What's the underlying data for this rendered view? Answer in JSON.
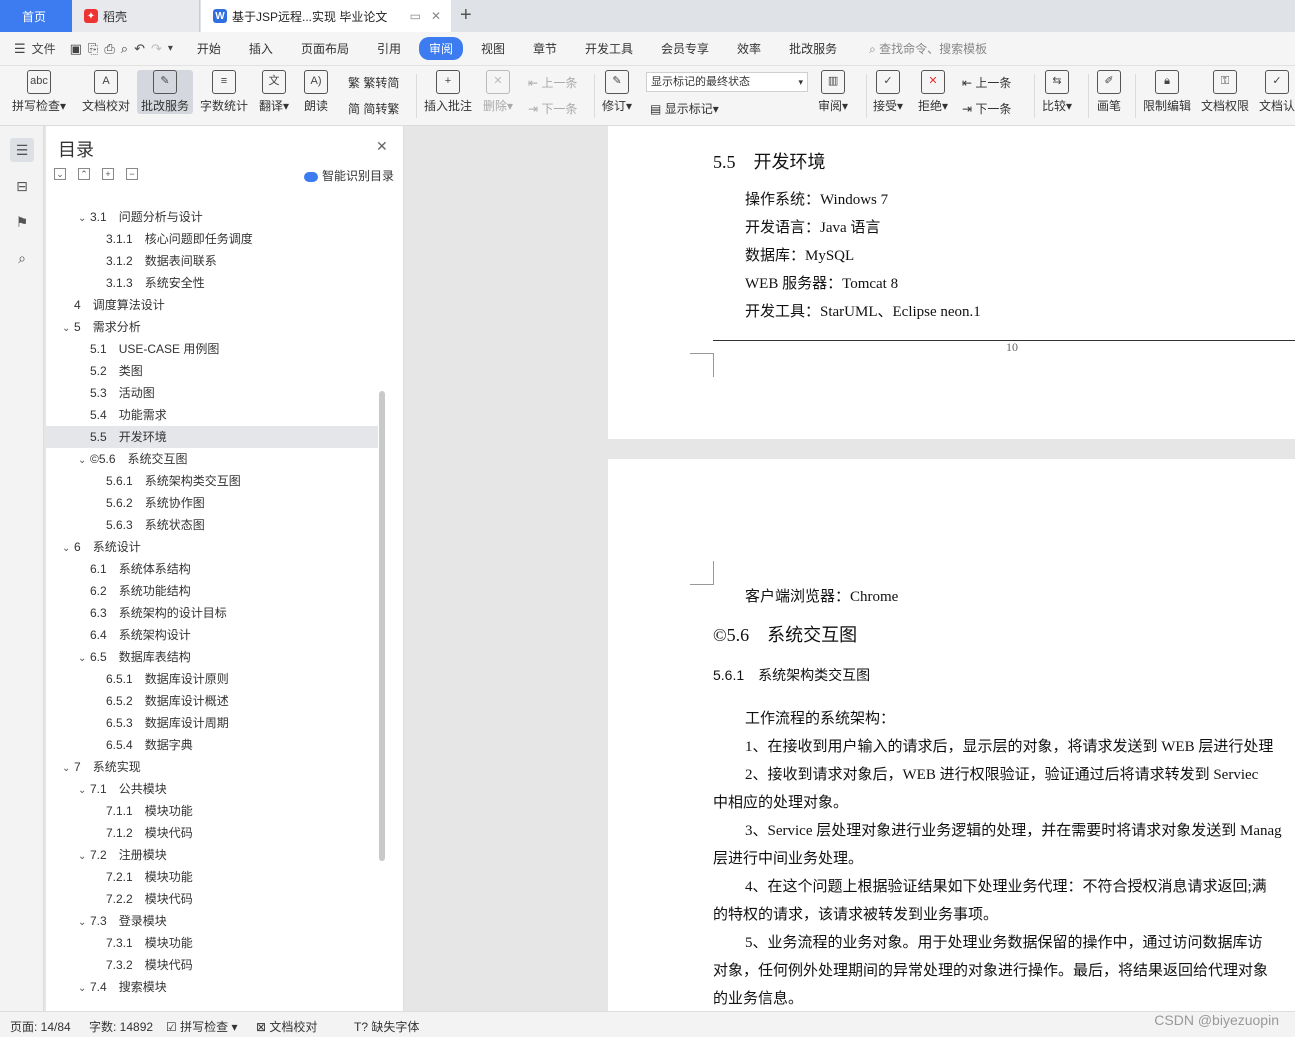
{
  "tabs": {
    "home": "首页",
    "daoke": "稻壳",
    "document": "基于JSP远程...实现 毕业论文"
  },
  "menu": {
    "file": "文件",
    "items": [
      "开始",
      "插入",
      "页面布局",
      "引用",
      "审阅",
      "视图",
      "章节",
      "开发工具",
      "会员专享",
      "效率",
      "批改服务"
    ],
    "active": "审阅",
    "search": "查找命令、搜索模板"
  },
  "ribbon": {
    "spellcheck": "拼写检查",
    "doc_proof": "文档校对",
    "correction": "批改服务",
    "word_count": "字数统计",
    "translate": "翻译",
    "read_aloud": "朗读",
    "trad_to_simp": "繁转简",
    "simp_to_trad": "简转繁",
    "insert_comment": "插入批注",
    "delete": "删除",
    "prev_item": "上一条",
    "next_item": "下一条",
    "revise": "修订",
    "markup_state": "显示标记的最终状态",
    "show_markup": "显示标记",
    "review": "审阅",
    "accept": "接受",
    "reject": "拒绝",
    "prev": "上一条",
    "next": "下一条",
    "compare": "比较",
    "pen": "画笔",
    "restrict_edit": "限制编辑",
    "doc_permission": "文档权限",
    "doc_cert": "文档认"
  },
  "toc": {
    "title": "目录",
    "smart": "智能识别目录",
    "items": [
      {
        "num": "3.1",
        "text": "问题分析与设计",
        "level": 2,
        "caret": true
      },
      {
        "num": "3.1.1",
        "text": "核心问题即任务调度",
        "level": 3
      },
      {
        "num": "3.1.2",
        "text": "数据表间联系",
        "level": 3
      },
      {
        "num": "3.1.3",
        "text": "系统安全性",
        "level": 3
      },
      {
        "num": "4",
        "text": "调度算法设计",
        "level": 1
      },
      {
        "num": "5",
        "text": "需求分析",
        "level": 1,
        "caret": true
      },
      {
        "num": "5.1",
        "text": "USE-CASE 用例图",
        "level": 2
      },
      {
        "num": "5.2",
        "text": "类图",
        "level": 2
      },
      {
        "num": "5.3",
        "text": "活动图",
        "level": 2
      },
      {
        "num": "5.4",
        "text": "功能需求",
        "level": 2
      },
      {
        "num": "5.5",
        "text": "开发环境",
        "level": 2,
        "selected": true
      },
      {
        "num": "©5.6",
        "text": "系统交互图",
        "level": 2,
        "caret": true
      },
      {
        "num": "5.6.1",
        "text": "系统架构类交互图",
        "level": 3
      },
      {
        "num": "5.6.2",
        "text": "系统协作图",
        "level": 3
      },
      {
        "num": "5.6.3",
        "text": "系统状态图",
        "level": 3
      },
      {
        "num": "6",
        "text": "系统设计",
        "level": 1,
        "caret": true
      },
      {
        "num": "6.1",
        "text": "系统体系结构",
        "level": 2
      },
      {
        "num": "6.2",
        "text": "系统功能结构",
        "level": 2
      },
      {
        "num": "6.3",
        "text": "系统架构的设计目标",
        "level": 2
      },
      {
        "num": "6.4",
        "text": "系统架构设计",
        "level": 2
      },
      {
        "num": "6.5",
        "text": "数据库表结构",
        "level": 2,
        "caret": true
      },
      {
        "num": "6.5.1",
        "text": "数据库设计原则",
        "level": 3
      },
      {
        "num": "6.5.2",
        "text": "数据库设计概述",
        "level": 3
      },
      {
        "num": "6.5.3",
        "text": "数据库设计周期",
        "level": 3
      },
      {
        "num": "6.5.4",
        "text": "数据字典",
        "level": 3
      },
      {
        "num": "7",
        "text": "系统实现",
        "level": 1,
        "caret": true
      },
      {
        "num": "7.1",
        "text": "公共模块",
        "level": 2,
        "caret": true
      },
      {
        "num": "7.1.1",
        "text": "模块功能",
        "level": 3
      },
      {
        "num": "7.1.2",
        "text": "模块代码",
        "level": 3
      },
      {
        "num": "7.2",
        "text": "注册模块",
        "level": 2,
        "caret": true
      },
      {
        "num": "7.2.1",
        "text": "模块功能",
        "level": 3
      },
      {
        "num": "7.2.2",
        "text": "模块代码",
        "level": 3
      },
      {
        "num": "7.3",
        "text": "登录模块",
        "level": 2,
        "caret": true
      },
      {
        "num": "7.3.1",
        "text": "模块功能",
        "level": 3
      },
      {
        "num": "7.3.2",
        "text": "模块代码",
        "level": 3
      },
      {
        "num": "7.4",
        "text": "搜索模块",
        "level": 2,
        "caret": true
      }
    ]
  },
  "doc": {
    "page1": {
      "heading": "5.5　开发环境",
      "lines": [
        "操作系统：Windows 7",
        "开发语言：Java 语言",
        "数据库：MySQL",
        "WEB 服务器：Tomcat 8",
        "开发工具：StarUML、Eclipse neon.1"
      ],
      "page_number": "10"
    },
    "page2": {
      "line0": "客户端浏览器：Chrome",
      "heading": "©5.6　系统交互图",
      "subheading": "5.6.1　系统架构类交互图",
      "paras": [
        "工作流程的系统架构：",
        "1、在接收到用户输入的请求后，显示层的对象，将请求发送到 WEB 层进行处理",
        "2、接收到请求对象后，WEB 进行权限验证，验证通过后将请求转发到 Serviec",
        "中相应的处理对象。",
        "3、Service 层处理对象进行业务逻辑的处理，并在需要时将请求对象发送到 Manag",
        "层进行中间业务处理。",
        "4、在这个问题上根据验证结果如下处理业务代理：不符合授权消息请求返回;满",
        "的特权的请求，该请求被转发到业务事项。",
        "5、业务流程的业务对象。用于处理业务数据保留的操作中，通过访问数据库访",
        "对象，任何例外处理期间的异常处理的对象进行操作。最后，将结果返回给代理对象",
        "的业务信息。"
      ]
    }
  },
  "status": {
    "page": "页面: 14/84",
    "words": "字数: 14892",
    "spell": "拼写检查",
    "proof": "文档校对",
    "missing_font": "缺失字体"
  },
  "watermark": "CSDN @biyezuopin"
}
